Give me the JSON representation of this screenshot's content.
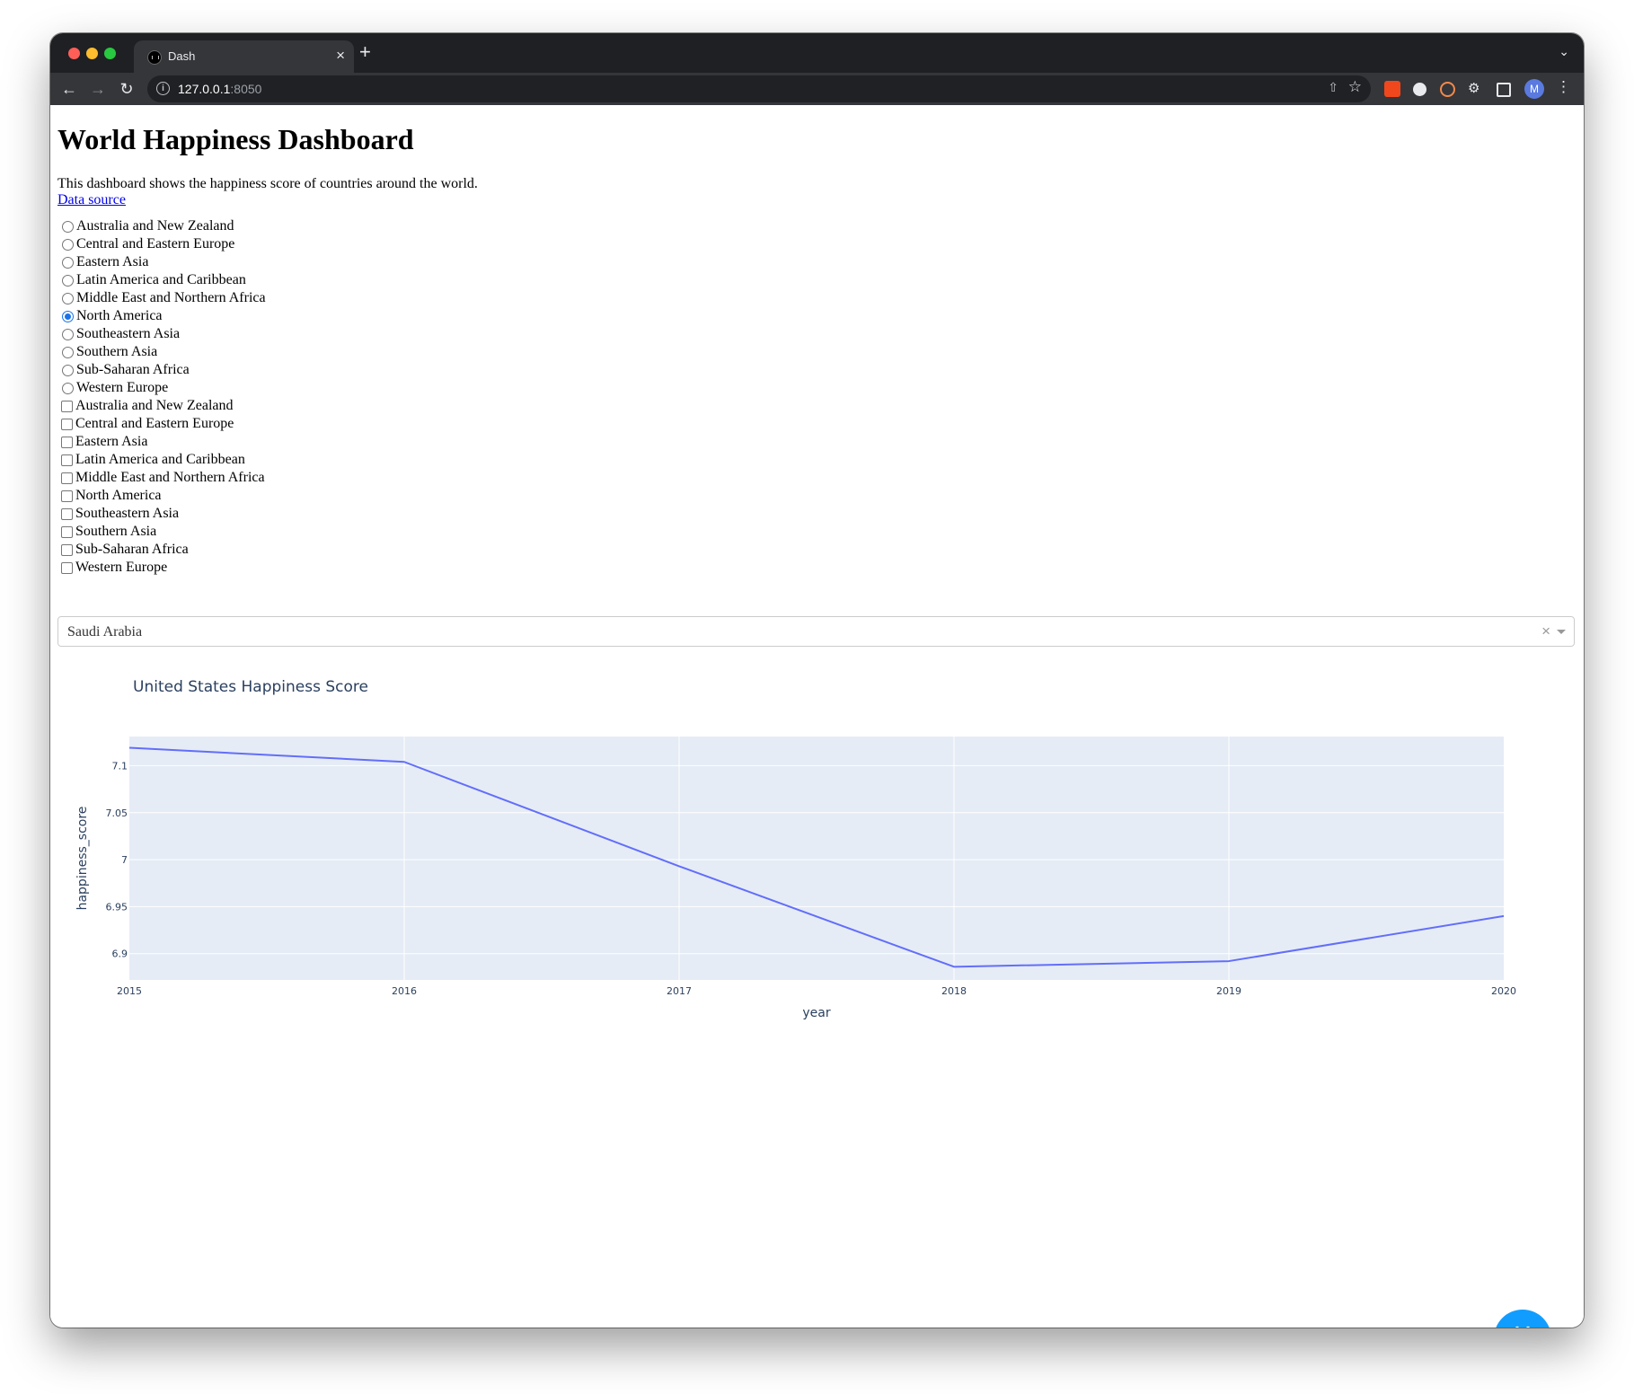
{
  "browser": {
    "tab_title": "Dash",
    "tab_close": "×",
    "new_tab": "+",
    "url_host": "127.0.0.1",
    "url_port": ":8050",
    "profile_initial": "M"
  },
  "page": {
    "title": "World Happiness Dashboard",
    "description": "This dashboard shows the happiness score of countries around the world.",
    "source_link": "Data source"
  },
  "regions_radio": {
    "selected": "North America",
    "options": [
      "Australia and New Zealand",
      "Central and Eastern Europe",
      "Eastern Asia",
      "Latin America and Caribbean",
      "Middle East and Northern Africa",
      "North America",
      "Southeastern Asia",
      "Southern Asia",
      "Sub-Saharan Africa",
      "Western Europe"
    ]
  },
  "regions_checklist": {
    "options": [
      "Australia and New Zealand",
      "Central and Eastern Europe",
      "Eastern Asia",
      "Latin America and Caribbean",
      "Middle East and Northern Africa",
      "North America",
      "Southeastern Asia",
      "Southern Asia",
      "Sub-Saharan Africa",
      "Western Europe"
    ],
    "checked": []
  },
  "country_dropdown": {
    "value": "Saudi Arabia",
    "clear_symbol": "×"
  },
  "chart_data": {
    "type": "line",
    "title": "United States Happiness Score",
    "xlabel": "year",
    "ylabel": "happiness_score",
    "x": [
      2015,
      2016,
      2017,
      2018,
      2019,
      2020
    ],
    "x_ticks": [
      "2015",
      "2016",
      "2017",
      "2018",
      "2019",
      "2020"
    ],
    "y_ticks": [
      "6.9",
      "6.95",
      "7",
      "7.05",
      "7.1"
    ],
    "xlim": [
      2015,
      2020
    ],
    "ylim": [
      6.872,
      7.131
    ],
    "series": [
      {
        "values": [
          7.119,
          7.104,
          6.993,
          6.886,
          6.892,
          6.94
        ],
        "color": "#636efa"
      }
    ],
    "grid": true,
    "plot_bg": "#e5ecf6"
  },
  "colors": {
    "chrome_dark": "#1f2023",
    "accent_blue": "#119dff",
    "plot_text": "#2a3f5f"
  },
  "fab_icon": "code-icon"
}
